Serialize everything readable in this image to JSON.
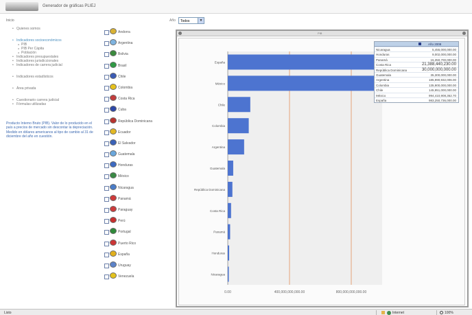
{
  "app": {
    "title": "Generador de gráficas PLIEJ"
  },
  "sidebar": {
    "heading": "Inicio",
    "items": [
      {
        "label": "Quienes somos",
        "kind": "item"
      },
      {
        "label": "Indicadores socioeconómicos",
        "kind": "active-gap"
      },
      {
        "label": "PIB",
        "kind": "sub"
      },
      {
        "label": "PIB Per Cápita",
        "kind": "sub"
      },
      {
        "label": "Población",
        "kind": "sub"
      },
      {
        "label": "Indicadores presupuestales",
        "kind": "item"
      },
      {
        "label": "Indicadores jurisdiccionales",
        "kind": "item"
      },
      {
        "label": "Indicadores de carrera judicial",
        "kind": "item"
      },
      {
        "label": "Indicadores estadísticos",
        "kind": "gap"
      },
      {
        "label": "Área privada",
        "kind": "gap"
      },
      {
        "label": "Cuestionario carrera judicial",
        "kind": "gap"
      },
      {
        "label": "Fórmulas utilizadas",
        "kind": "item"
      }
    ],
    "description": "Producto Interno Bruto (PIB). Valor de lo producido en el país a precios de mercado sin descontar la depreciación. Medido en dólares americanos al tipo de cambio al 31 de diciembre del año en cuestión."
  },
  "countries": [
    {
      "name": "Andorra",
      "color": "#d9b233"
    },
    {
      "name": "Argentina",
      "color": "#7fb4e0"
    },
    {
      "name": "Bolivia",
      "color": "#3a8a3d"
    },
    {
      "name": "Brasil",
      "color": "#2f9a45"
    },
    {
      "name": "Chile",
      "color": "#3b5bb5"
    },
    {
      "name": "Colombia",
      "color": "#e6c11c"
    },
    {
      "name": "Costa Rica",
      "color": "#c33d3d"
    },
    {
      "name": "Cuba",
      "color": "#2d48a8"
    },
    {
      "name": "República Dominicana",
      "color": "#b8342f"
    },
    {
      "name": "Ecuador",
      "color": "#e2b824"
    },
    {
      "name": "El Salvador",
      "color": "#3a62b8"
    },
    {
      "name": "Guatemala",
      "color": "#6aa7dc"
    },
    {
      "name": "Honduras",
      "color": "#3d6ac2"
    },
    {
      "name": "México",
      "color": "#3a8a45"
    },
    {
      "name": "Nicaragua",
      "color": "#4a7cc8"
    },
    {
      "name": "Panamá",
      "color": "#cf3a3a"
    },
    {
      "name": "Paraguay",
      "color": "#cc3b3b"
    },
    {
      "name": "Perú",
      "color": "#c7302e"
    },
    {
      "name": "Portugal",
      "color": "#2f8a3a"
    },
    {
      "name": "Puerto Rico",
      "color": "#cc3636"
    },
    {
      "name": "España",
      "color": "#e1b01d"
    },
    {
      "name": "Uruguay",
      "color": "#5c83c9"
    },
    {
      "name": "Venezuela",
      "color": "#e3c21d"
    }
  ],
  "filter": {
    "label": "Año",
    "selected": "Todos"
  },
  "panel": {
    "title": "PIB"
  },
  "table": {
    "column": "Año 2008",
    "rows": [
      {
        "country": "Nicaragua",
        "value": "5,455,000,000.00"
      },
      {
        "country": "Honduras",
        "value": "9,002,000,000.00"
      },
      {
        "country": "Panamá",
        "value": "15,350,700,000.00"
      },
      {
        "country": "Costa Rica",
        "value": "21,388,440,230.00"
      },
      {
        "country": "República Dominicana",
        "value": "30,000,000,000.00"
      },
      {
        "country": "Guatemala",
        "value": "35,300,000,000.00"
      },
      {
        "country": "Argentina",
        "value": "185,990,932,006.00"
      },
      {
        "country": "Colombia",
        "value": "135,900,000,000.00"
      },
      {
        "country": "Chile",
        "value": "145,951,000,000.00"
      },
      {
        "country": "México",
        "value": "994,410,908,362.70"
      },
      {
        "country": "España",
        "value": "983,250,736,000.00"
      }
    ]
  },
  "chart_data": {
    "type": "bar",
    "orientation": "horizontal",
    "categories": [
      "España",
      "México",
      "Chile",
      "Colombia",
      "Argentina",
      "Guatemala",
      "República Dominicana",
      "Costa Rica",
      "Panamá",
      "Honduras",
      "Nicaragua"
    ],
    "values": [
      983250736000,
      954410908362,
      145951000000,
      135900000000,
      105990932006,
      35300000000,
      30000000000,
      21388440230,
      15350700000,
      9002000000,
      5455000000
    ],
    "tick_labels": [
      "0.00",
      "400,000,000,000.00",
      "800,000,000,000.00"
    ],
    "xlim": [
      0,
      1000000000000
    ],
    "grid": true,
    "bar_color": "#4d74d0"
  },
  "statusbar": {
    "left": "Listo",
    "zone": "Internet",
    "zoom": "100%"
  }
}
